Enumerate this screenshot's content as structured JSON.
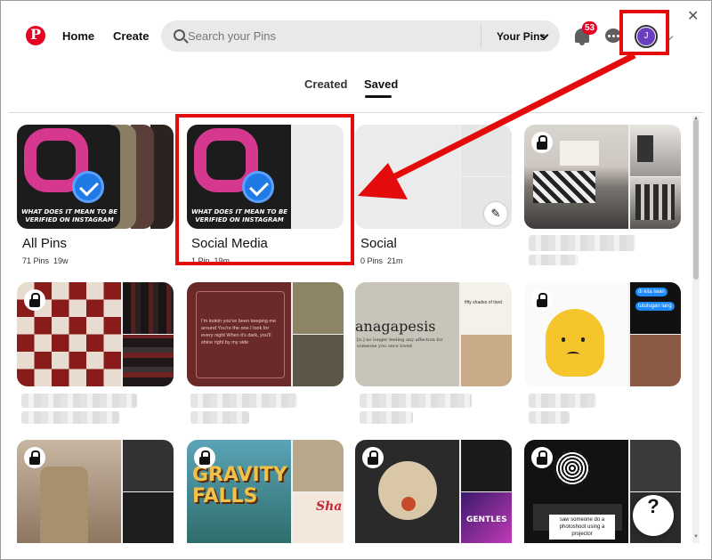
{
  "header": {
    "logo_glyph": "P",
    "home_label": "Home",
    "create_label": "Create",
    "search_placeholder": "Search your Pins",
    "scope_label": "Your Pins",
    "notification_count": "53",
    "avatar_letter": "J"
  },
  "tabs": [
    {
      "label": "Created",
      "selected": false
    },
    {
      "label": "Saved",
      "selected": true
    }
  ],
  "boards": [
    {
      "title": "All Pins",
      "pins": "71 Pins",
      "age": "19w"
    },
    {
      "title": "Social Media",
      "pins": "1 Pin",
      "age": "19m"
    },
    {
      "title": "Social",
      "pins": "0 Pins",
      "age": "21m"
    }
  ],
  "pin_texts": {
    "instagram_caption": "WHAT DOES IT MEAN TO BE VERIFIED ON INSTAGRAM",
    "anagapesis_title": "anagapesis",
    "anagapesis_body": "[n.] no longer feeling any affection for someone you once loved",
    "fifty_shades": "fifty shades of tired",
    "keeping_me": "I'm lookin you've been keeping me around You're the one I look for every night When it's dark, you'll shine right by my side",
    "chat_1": "di kita iwan",
    "chat_2": "tutulugan lang",
    "gravity": "GRAVITY FALLS",
    "sha": "Sha",
    "tv_caption": "saw someone do a photoshoot using a projector",
    "gentles": "GENTLES"
  },
  "help_label": "?",
  "window_close": "✕",
  "colors": {
    "brand": "#e60023",
    "annotation": "#e30b0b"
  }
}
